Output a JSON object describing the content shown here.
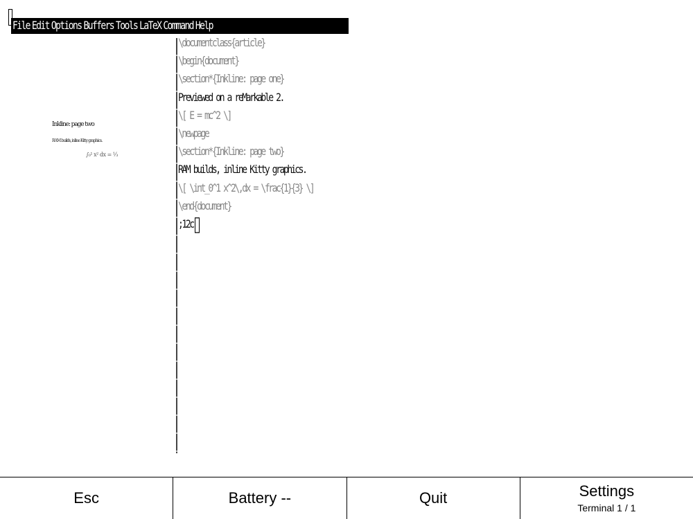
{
  "menubar": {
    "items": [
      "File",
      "Edit",
      "Options",
      "Buffers",
      "Tools",
      "LaTeX",
      "Command",
      "Help"
    ]
  },
  "preview": {
    "heading": "Inkline: page two",
    "body": "RAM builds, inline Kitty graphics.",
    "math": "∫₀¹ x² dx = ⅓"
  },
  "editor": {
    "lines": [
      "\\documentclass{article}",
      "\\begin{document}",
      "\\section*{Inkline: page one}",
      "Previewed on a reMarkable 2.",
      "\\[ E = mc^2 \\]",
      "\\newpage",
      "\\section*{Inkline: page two}",
      "RAM builds, inline Kitty graphics.",
      "\\[ \\int_0^1 x^2\\,dx = \\frac{1}{3} \\]",
      "\\end{document}",
      ";12c"
    ]
  },
  "bottombar": {
    "esc": "Esc",
    "battery": "Battery --",
    "quit": "Quit",
    "settings": "Settings",
    "terminal": "Terminal 1 / 1"
  }
}
